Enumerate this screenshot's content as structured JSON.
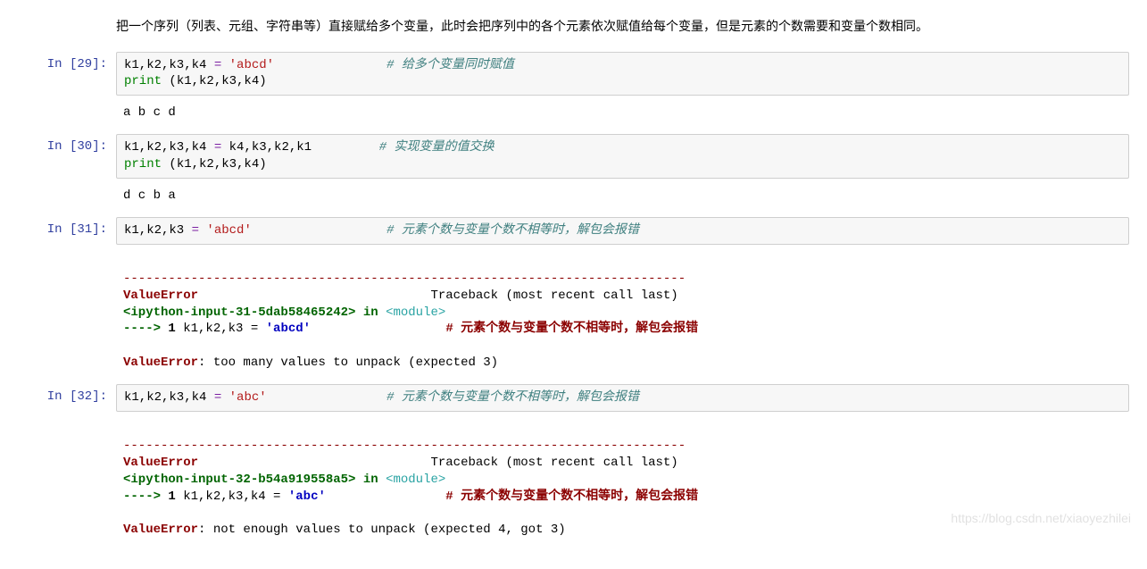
{
  "intro": "把一个序列（列表、元组、字符串等）直接赋给多个变量，此时会把序列中的各个元素依次赋值给每个变量，但是元素的个数需要和变量个数相同。",
  "cells": [
    {
      "prompt": "In [29]:",
      "code": {
        "line1_left": "k1,k2,k3,k4 ",
        "eq": "=",
        "line1_str": " 'abcd'",
        "line1_pad": "               ",
        "line1_cmt": "# 给多个变量同时赋值",
        "line2_print": "print",
        "line2_tail": " (k1,k2,k3,k4)"
      },
      "out": "a b c d"
    },
    {
      "prompt": "In [30]:",
      "code": {
        "line1_left": "k1,k2,k3,k4 ",
        "eq": "=",
        "line1_right": " k4,k3,k2,k1",
        "line1_pad": "         ",
        "line1_cmt": "# 实现变量的值交换",
        "line2_print": "print",
        "line2_tail": " (k1,k2,k3,k4)"
      },
      "out": "d c b a"
    },
    {
      "prompt": "In [31]:",
      "code": {
        "line1_left": "k1,k2,k3 ",
        "eq": "=",
        "line1_str": " 'abcd'",
        "line1_pad": "                  ",
        "line1_cmt": "# 元素个数与变量个数不相等时，解包会报错"
      },
      "err": {
        "dash": "---------------------------------------------------------------------------",
        "head_name": "ValueError",
        "head_tail": "                               Traceback (most recent call last)",
        "loc": "<ipython-input-31-5dab58465242>",
        "in_word": " in ",
        "module": "<module>",
        "arrow": "----> ",
        "num": "1",
        "code_plain": " k1,k2,k3 = ",
        "code_str": "'abcd'",
        "code_pad": "                  ",
        "code_cmt": "# 元素个数与变量个数不相等时，解包会报错",
        "final_name": "ValueError",
        "final_msg": ": too many values to unpack (expected 3)"
      }
    },
    {
      "prompt": "In [32]:",
      "code": {
        "line1_left": "k1,k2,k3,k4 ",
        "eq": "=",
        "line1_str": " 'abc'",
        "line1_pad": "                ",
        "line1_cmt": "# 元素个数与变量个数不相等时，解包会报错"
      },
      "err": {
        "dash": "---------------------------------------------------------------------------",
        "head_name": "ValueError",
        "head_tail": "                               Traceback (most recent call last)",
        "loc": "<ipython-input-32-b54a919558a5>",
        "in_word": " in ",
        "module": "<module>",
        "arrow": "----> ",
        "num": "1",
        "code_plain": " k1,k2,k3,k4 = ",
        "code_str": "'abc'",
        "code_pad": "                ",
        "code_cmt": "# 元素个数与变量个数不相等时，解包会报错",
        "final_name": "ValueError",
        "final_msg": ": not enough values to unpack (expected 4, got 3)"
      }
    }
  ],
  "watermark": "https://blog.csdn.net/xiaoyezhilei"
}
